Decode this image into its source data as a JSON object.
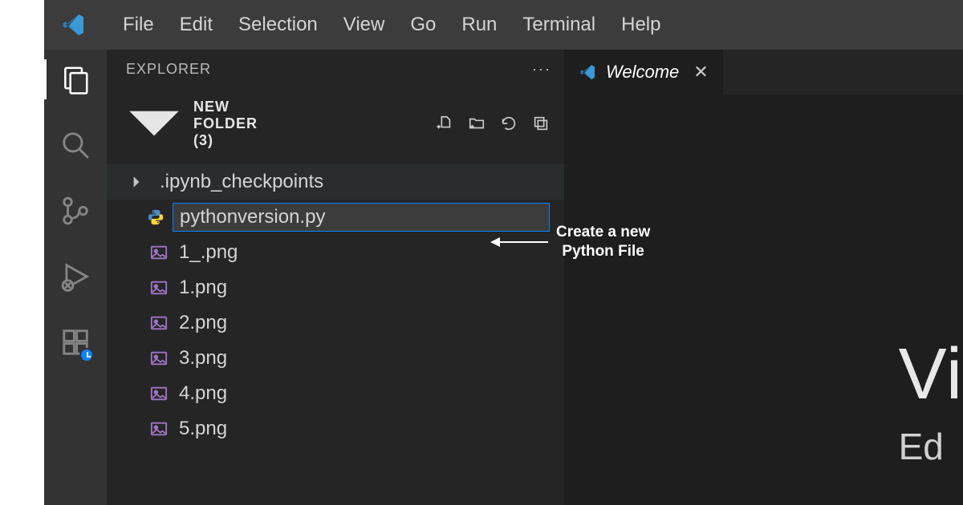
{
  "menubar": {
    "items": [
      "File",
      "Edit",
      "Selection",
      "View",
      "Go",
      "Run",
      "Terminal",
      "Help"
    ]
  },
  "activitybar": {
    "items": [
      {
        "name": "explorer",
        "active": true
      },
      {
        "name": "search",
        "active": false
      },
      {
        "name": "source-control",
        "active": false
      },
      {
        "name": "run-debug",
        "active": false
      },
      {
        "name": "extensions",
        "active": false,
        "badge": "clock"
      }
    ]
  },
  "sidebar": {
    "title": "EXPLORER",
    "folder_label": "NEW FOLDER (3)",
    "new_file_value": "pythonversion.py",
    "tree": [
      {
        "type": "folder",
        "label": ".ipynb_checkpoints",
        "expanded": false,
        "hovered": true
      },
      {
        "type": "newfile"
      },
      {
        "type": "file",
        "label": "1_.png",
        "icon": "image"
      },
      {
        "type": "file",
        "label": "1.png",
        "icon": "image"
      },
      {
        "type": "file",
        "label": "2.png",
        "icon": "image"
      },
      {
        "type": "file",
        "label": "3.png",
        "icon": "image"
      },
      {
        "type": "file",
        "label": "4.png",
        "icon": "image"
      },
      {
        "type": "file",
        "label": "5.png",
        "icon": "image"
      }
    ]
  },
  "editor": {
    "tab_label": "Welcome",
    "welcome_heading": "Vi",
    "welcome_sub": "Ed"
  },
  "annotation": {
    "text_line1": "Create a new",
    "text_line2": "Python File"
  }
}
